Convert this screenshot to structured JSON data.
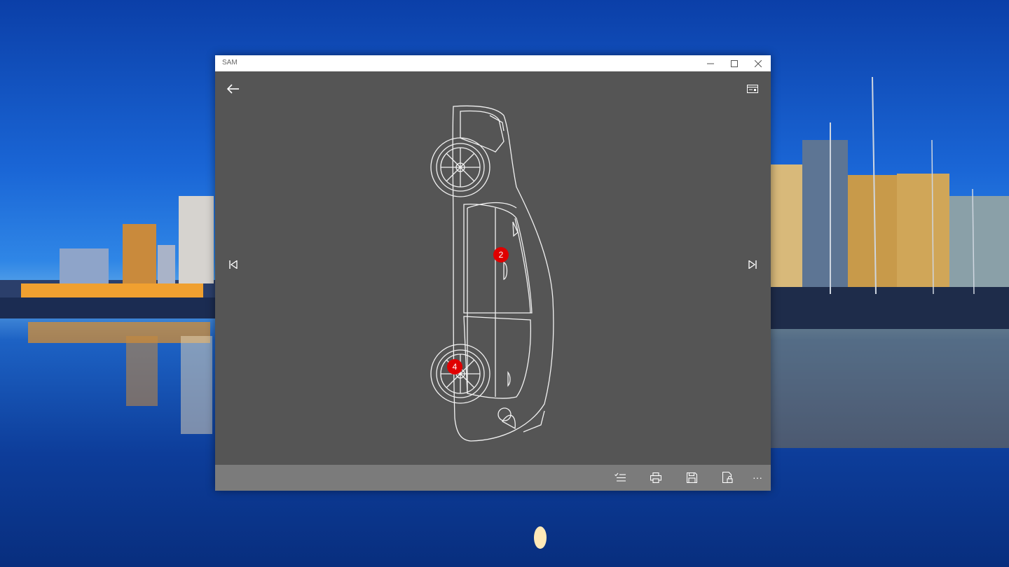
{
  "window": {
    "title": "SAM"
  },
  "markers": [
    {
      "label": "2"
    },
    {
      "label": "4"
    }
  ],
  "icons": {
    "back": "back-arrow-icon",
    "card": "card-icon",
    "previous": "skip-previous-icon",
    "next": "skip-next-icon",
    "checklist": "checklist-icon",
    "print": "print-icon",
    "save": "save-icon",
    "lock": "lock-document-icon",
    "more": "more-icon"
  },
  "bottombar": {
    "more_label": "···"
  },
  "colors": {
    "canvas": "#555555",
    "titlebar": "#ffffff",
    "bottombar": "#7b7b7b",
    "marker": "#e00000"
  }
}
